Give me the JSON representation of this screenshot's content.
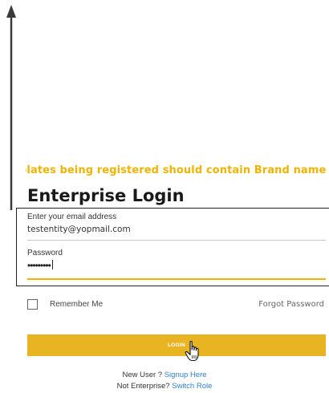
{
  "marquee": {
    "text": "plates being registered should contain Brand name or Entity na"
  },
  "page": {
    "title": "Enterprise Login"
  },
  "email": {
    "label": "Enter your email address",
    "value": "testentity@yopmail.com"
  },
  "password": {
    "label": "Password",
    "value": "•••••••••"
  },
  "remember": {
    "label": "Remember Me",
    "checked": false
  },
  "forgot": {
    "label": "Forgot Password"
  },
  "login": {
    "label": "LOGIN"
  },
  "signup": {
    "prompt": "New User ?",
    "link": "Signup Here"
  },
  "switch_role": {
    "prompt": "Not Enterprise?",
    "link": "Switch Role"
  },
  "colors": {
    "accent": "#e8b424",
    "marquee": "#f0b400",
    "link": "#2f7fcf",
    "annotation": "#222222"
  },
  "icons": {
    "annotation_arrow": "up-arrow-icon",
    "pointer": "hand-pointer-icon"
  }
}
